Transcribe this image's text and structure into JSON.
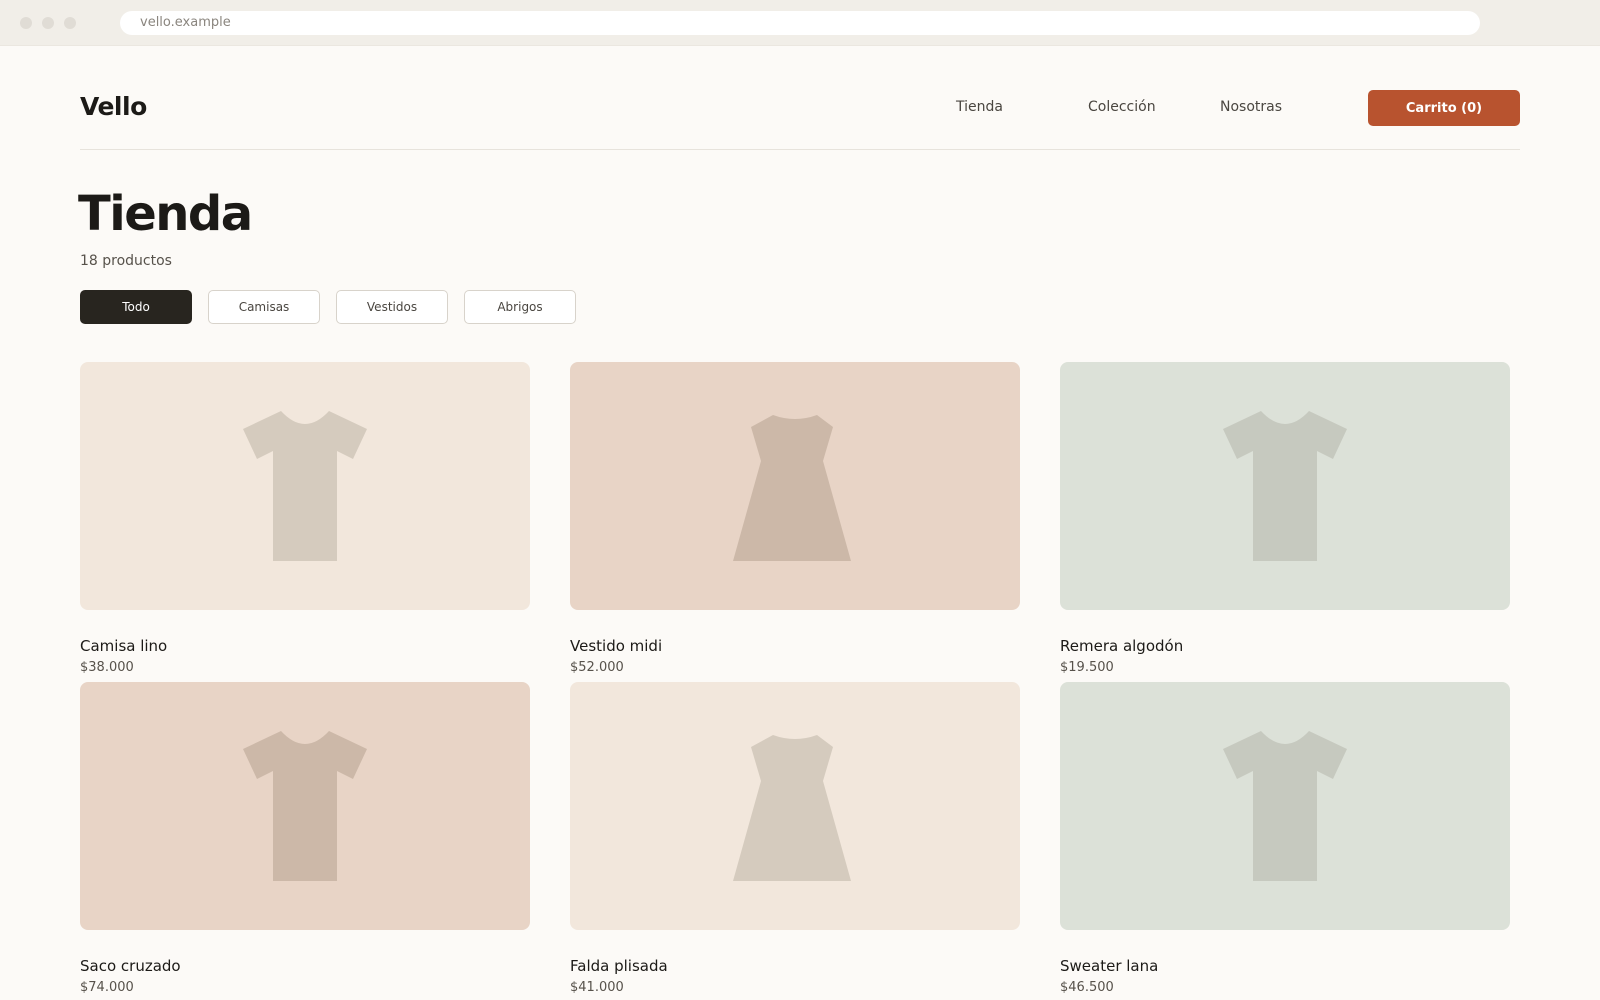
{
  "browser": {
    "url": "vello.example"
  },
  "header": {
    "logo": "Vello",
    "nav": [
      "Tienda",
      "Colección",
      "Nosotras"
    ],
    "cart_label": "Carrito (0)"
  },
  "page": {
    "title": "Tienda",
    "count": "18 productos"
  },
  "filters": [
    {
      "label": "Todo",
      "active": true
    },
    {
      "label": "Camisas",
      "active": false
    },
    {
      "label": "Vestidos",
      "active": false
    },
    {
      "label": "Abrigos",
      "active": false
    }
  ],
  "colors": {
    "accent": "#b8532f",
    "active_filter": "#28251f",
    "tile_cream": "#f2e7dc",
    "tile_rose": "#e8d4c6",
    "tile_sage": "#dce1d8"
  },
  "products": [
    {
      "name": "Camisa lino",
      "price": "$38.000",
      "icon": "shirt-icon",
      "tile": "#f2e7dc",
      "fill": "#d5cbbe"
    },
    {
      "name": "Vestido midi",
      "price": "$52.000",
      "icon": "dress-icon",
      "tile": "#e8d4c6",
      "fill": "#ccb8a8"
    },
    {
      "name": "Remera algodón",
      "price": "$19.500",
      "icon": "shirt-icon",
      "tile": "#dce1d8",
      "fill": "#c6c9bf"
    },
    {
      "name": "Saco cruzado",
      "price": "$74.000",
      "icon": "shirt-icon",
      "tile": "#e8d4c6",
      "fill": "#ccb8a8"
    },
    {
      "name": "Falda plisada",
      "price": "$41.000",
      "icon": "dress-icon",
      "tile": "#f2e7dc",
      "fill": "#d5cbbe"
    },
    {
      "name": "Sweater lana",
      "price": "$46.500",
      "icon": "shirt-icon",
      "tile": "#dce1d8",
      "fill": "#c6c9bf"
    }
  ]
}
